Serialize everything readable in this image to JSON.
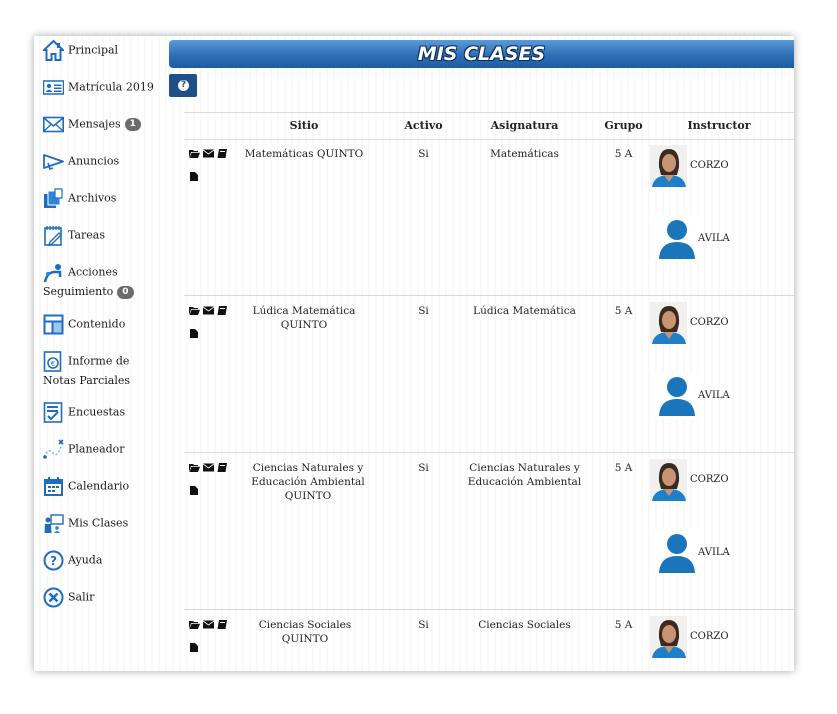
{
  "sidebar": {
    "items": [
      {
        "label": "Principal",
        "icon": "home-icon"
      },
      {
        "label": "Matrícula 2019",
        "icon": "id-card-icon"
      },
      {
        "label": "Mensajes",
        "icon": "envelope-icon",
        "badge": "1"
      },
      {
        "label": "Anuncios",
        "icon": "megaphone-icon"
      },
      {
        "label": "Archivos",
        "icon": "files-icon"
      },
      {
        "label": "Tareas",
        "icon": "notepad-icon"
      },
      {
        "label": "Acciones",
        "label2": "Seguimiento",
        "icon": "tracking-icon",
        "badge": "0"
      },
      {
        "label": "Contenido",
        "icon": "layout-icon"
      },
      {
        "label": "Informe de",
        "label2": "Notas Parciales",
        "icon": "report-icon"
      },
      {
        "label": "Encuestas",
        "icon": "survey-icon"
      },
      {
        "label": "Planeador",
        "icon": "planner-icon"
      },
      {
        "label": "Calendario",
        "icon": "calendar-icon"
      },
      {
        "label": "Mis Clases",
        "icon": "classroom-icon"
      },
      {
        "label": "Ayuda",
        "icon": "help-icon"
      },
      {
        "label": "Salir",
        "icon": "exit-icon"
      }
    ]
  },
  "header": {
    "title": "MIS CLASES",
    "help_icon": "question-icon"
  },
  "table": {
    "columns": {
      "sitio": "Sitio",
      "activo": "Activo",
      "asignatura": "Asignatura",
      "grupo": "Grupo",
      "instructor": "Instructor"
    },
    "rows": [
      {
        "sitio": "Matemáticas QUINTO",
        "activo": "Si",
        "asignatura": "Matemáticas",
        "grupo": "5 A",
        "instructors": [
          "CORZO",
          "AVILA"
        ]
      },
      {
        "sitio": "Lúdica Matemática QUINTO",
        "activo": "Si",
        "asignatura": "Lúdica Matemática",
        "grupo": "5 A",
        "instructors": [
          "CORZO",
          "AVILA"
        ]
      },
      {
        "sitio": "Ciencias Naturales y Educación Ambiental QUINTO",
        "activo": "Si",
        "asignatura": "Ciencias Naturales y Educación Ambiental",
        "grupo": "5 A",
        "instructors": [
          "CORZO",
          "AVILA"
        ]
      },
      {
        "sitio": "Ciencias Sociales QUINTO",
        "activo": "Si",
        "asignatura": "Ciencias Sociales",
        "grupo": "5 A",
        "instructors": [
          "CORZO"
        ]
      }
    ],
    "action_icons": [
      "folder-open-icon",
      "envelope-icon",
      "book-icon",
      "document-icon"
    ]
  },
  "colors": {
    "accent": "#2c6fb6",
    "help_button": "#1f4f88",
    "avatar_blue": "#1b75bb",
    "badge": "#6b6b6b"
  }
}
